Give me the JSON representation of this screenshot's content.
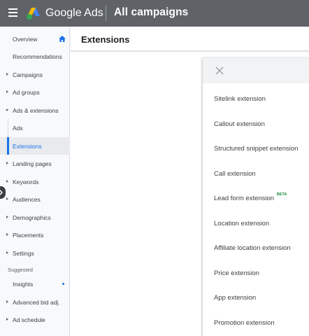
{
  "header": {
    "brand": "Google Ads",
    "breadcrumb": "All campaigns"
  },
  "sidebar": {
    "items": [
      {
        "label": "Overview"
      },
      {
        "label": "Recommendations"
      },
      {
        "label": "Campaigns"
      },
      {
        "label": "Ad groups"
      },
      {
        "label": "Ads & extensions"
      },
      {
        "label": "Ads"
      },
      {
        "label": "Extensions"
      },
      {
        "label": "Landing pages"
      },
      {
        "label": "Keywords"
      },
      {
        "label": "Audiences"
      },
      {
        "label": "Demographics"
      },
      {
        "label": "Placements"
      },
      {
        "label": "Settings"
      },
      {
        "label": "Insights"
      },
      {
        "label": "Advanced bid adj."
      },
      {
        "label": "Ad schedule"
      }
    ],
    "section_label": "Suggested"
  },
  "main": {
    "title": "Extensions"
  },
  "panel": {
    "options": [
      {
        "label": "Sitelink extension"
      },
      {
        "label": "Callout extension"
      },
      {
        "label": "Structured snippet extension"
      },
      {
        "label": "Call extension"
      },
      {
        "label": "Lead form extension",
        "badge": "BETA"
      },
      {
        "label": "Location extension"
      },
      {
        "label": "Affiliate location extension"
      },
      {
        "label": "Price extension"
      },
      {
        "label": "App extension"
      },
      {
        "label": "Promotion extension"
      }
    ]
  },
  "colors": {
    "topbar": "#5f6368",
    "accent": "#1a73e8",
    "beta": "#1e8e3e"
  }
}
